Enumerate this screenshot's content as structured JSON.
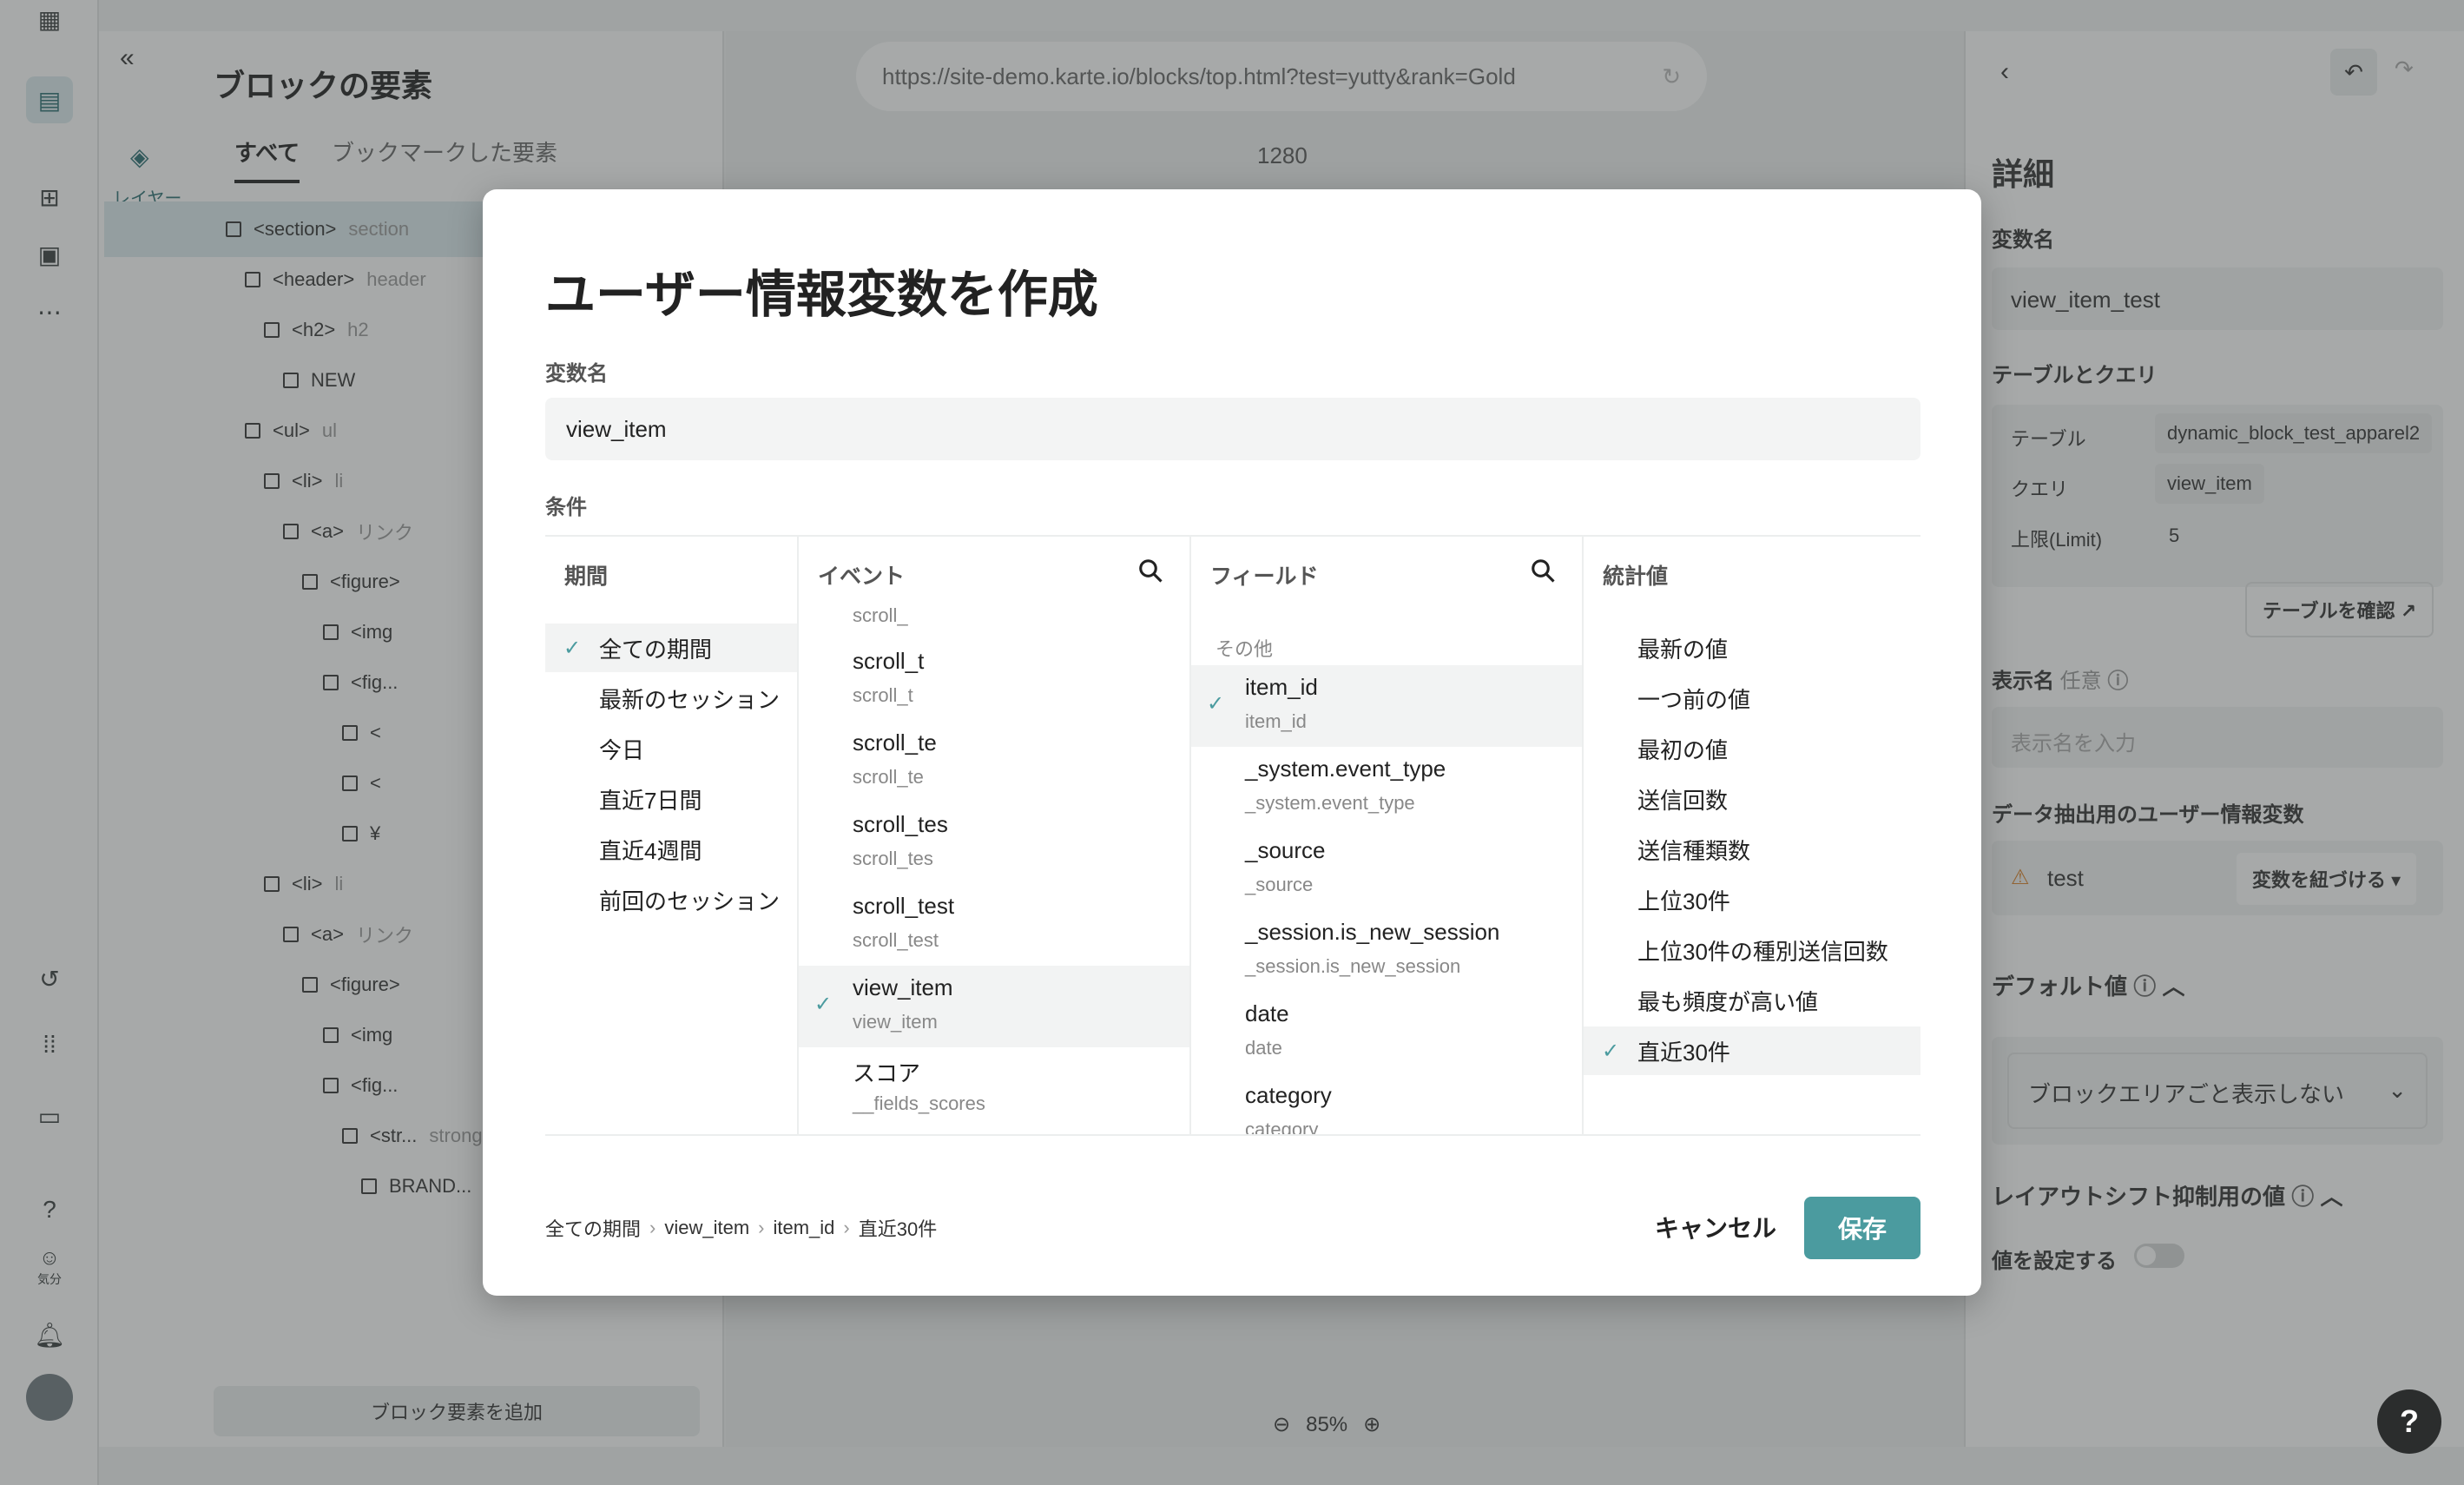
{
  "layers_panel": {
    "title": "ブロックの要素",
    "tabs": [
      "すべて",
      "ブックマークした要素"
    ],
    "side_tab": "レイヤー",
    "tree": [
      {
        "tag": "<section>",
        "name": "section"
      },
      {
        "tag": "<header>",
        "name": "header"
      },
      {
        "tag": "<h2>",
        "name": "h2"
      },
      {
        "tag": "NEW",
        "name": ""
      },
      {
        "tag": "<ul>",
        "name": "ul"
      },
      {
        "tag": "<li>",
        "name": "li"
      },
      {
        "tag": "<a>",
        "name": "リンク"
      },
      {
        "tag": "<figure>",
        "name": ""
      },
      {
        "tag": "<img",
        "name": ""
      },
      {
        "tag": "<fig...",
        "name": ""
      },
      {
        "tag": "<",
        "name": ""
      },
      {
        "tag": "<",
        "name": ""
      },
      {
        "tag": "¥",
        "name": ""
      },
      {
        "tag": "<li>",
        "name": "li"
      },
      {
        "tag": "<a>",
        "name": "リンク"
      },
      {
        "tag": "<figure>",
        "name": ""
      },
      {
        "tag": "<img",
        "name": ""
      },
      {
        "tag": "<fig...",
        "name": ""
      },
      {
        "tag": "<str...",
        "name": "strong"
      },
      {
        "tag": "BRAND...",
        "name": ""
      }
    ],
    "add_button": "ブロック要素を追加",
    "rail_mood_label": "気分"
  },
  "canvas": {
    "url": "https://site-demo.karte.io/blocks/top.html?test=yutty&rank=Gold",
    "width_label": "1280",
    "zoom": "85%"
  },
  "detail_panel": {
    "title": "詳細",
    "var_name_label": "変数名",
    "var_name_value": "view_item_test",
    "table_query_label": "テーブルとクエリ",
    "table_label": "テーブル",
    "table_value": "dynamic_block_test_apparel2",
    "query_label": "クエリ",
    "query_value": "view_item",
    "limit_label": "上限(Limit)",
    "limit_value": "5",
    "confirm_table": "テーブルを確認",
    "display_name_label": "表示名",
    "display_name_optional": "任意",
    "display_name_placeholder": "表示名を入力",
    "extract_label": "データ抽出用のユーザー情報変数",
    "extract_value": "test",
    "link_var_button": "変数を紐づける",
    "default_label": "デフォルト値",
    "default_value": "ブロックエリアごと表示しない",
    "layout_shift_label": "レイアウトシフト抑制用の値",
    "set_value_label": "値を設定する"
  },
  "modal": {
    "title": "ユーザー情報変数を作成",
    "var_name_label": "変数名",
    "var_name_value": "view_item",
    "conditions_label": "条件",
    "period": {
      "header": "期間",
      "options": [
        "全ての期間",
        "最新のセッション",
        "今日",
        "直近7日間",
        "直近4週間",
        "前回のセッション"
      ],
      "selected": "全ての期間"
    },
    "event": {
      "header": "イベント",
      "partial_top": "scroll_",
      "items": [
        {
          "main": "scroll_t",
          "sub": "scroll_t"
        },
        {
          "main": "scroll_te",
          "sub": "scroll_te"
        },
        {
          "main": "scroll_tes",
          "sub": "scroll_tes"
        },
        {
          "main": "scroll_test",
          "sub": "scroll_test"
        },
        {
          "main": "view_item",
          "sub": "view_item"
        },
        {
          "main": "スコア",
          "sub": "__fields_scores"
        }
      ],
      "selected": "view_item"
    },
    "field": {
      "header": "フィールド",
      "section": "その他",
      "items": [
        {
          "main": "item_id",
          "sub": "item_id"
        },
        {
          "main": "_system.event_type",
          "sub": "_system.event_type"
        },
        {
          "main": "_source",
          "sub": "_source"
        },
        {
          "main": "_session.is_new_session",
          "sub": "_session.is_new_session"
        },
        {
          "main": "date",
          "sub": "date"
        },
        {
          "main": "category",
          "sub": "category"
        }
      ],
      "selected": "item_id"
    },
    "stat": {
      "header": "統計値",
      "options": [
        "最新の値",
        "一つ前の値",
        "最初の値",
        "送信回数",
        "送信種類数",
        "上位30件",
        "上位30件の種別送信回数",
        "最も頻度が高い値",
        "直近30件"
      ],
      "selected": "直近30件"
    },
    "breadcrumb": [
      "全ての期間",
      "view_item",
      "item_id",
      "直近30件"
    ],
    "cancel": "キャンセル",
    "save": "保存"
  },
  "help_button": "?",
  "colors": {
    "accent": "#4b9b9f",
    "overlay": "rgba(60,64,64,0.45)"
  }
}
